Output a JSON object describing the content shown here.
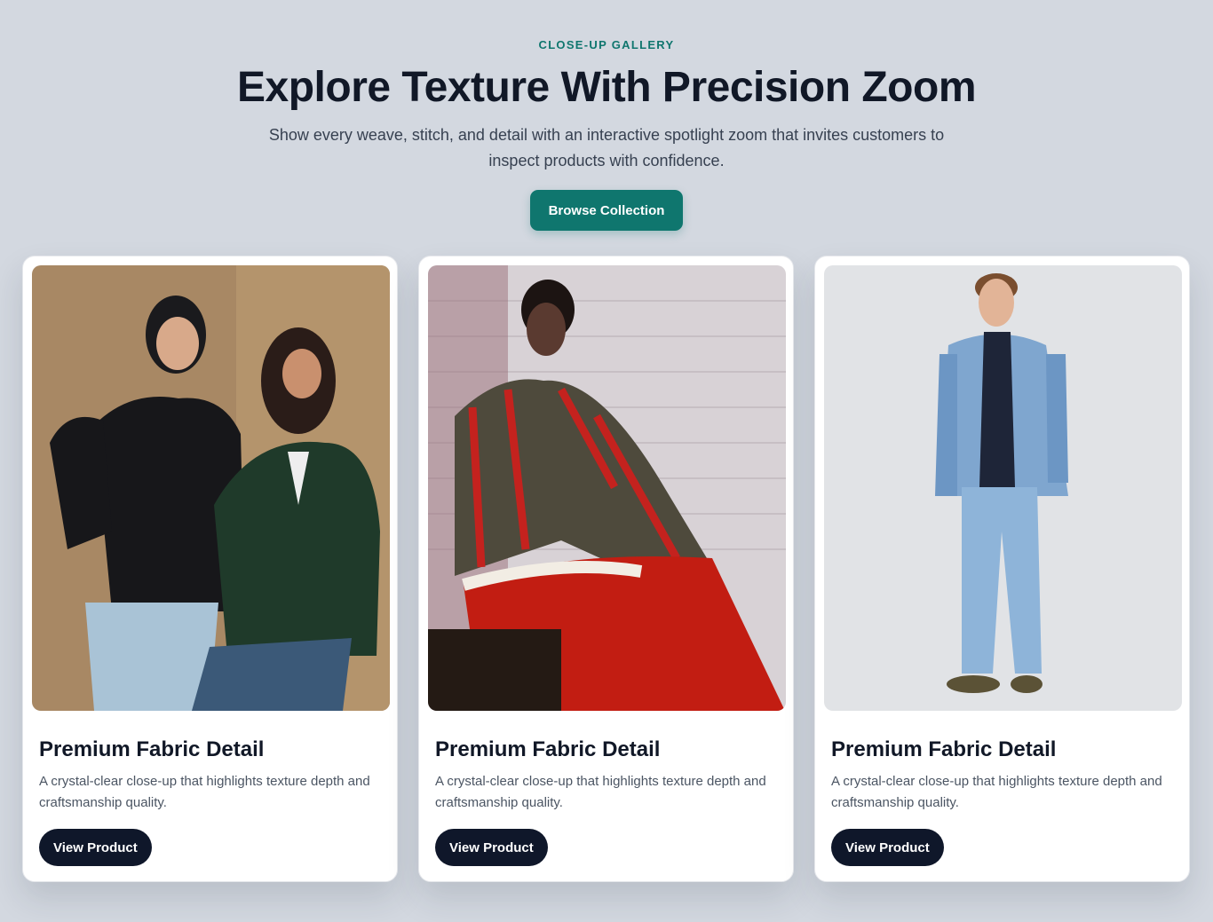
{
  "hero": {
    "eyebrow": "CLOSE-UP GALLERY",
    "title": "Explore Texture With Precision Zoom",
    "subtitle": "Show every weave, stitch, and detail with an interactive spotlight zoom that invites customers to inspect products with confidence.",
    "button_label": "Browse Collection"
  },
  "cards": [
    {
      "title": "Premium Fabric Detail",
      "description": "A crystal-clear close-up that highlights texture depth and craftsmanship quality.",
      "button_label": "View Product"
    },
    {
      "title": "Premium Fabric Detail",
      "description": "A crystal-clear close-up that highlights texture depth and craftsmanship quality.",
      "button_label": "View Product"
    },
    {
      "title": "Premium Fabric Detail",
      "description": "A crystal-clear close-up that highlights texture depth and craftsmanship quality.",
      "button_label": "View Product"
    }
  ],
  "colors": {
    "page_background": "#d3d8e0",
    "accent": "#0f766e",
    "dark_button": "#0f172a"
  }
}
